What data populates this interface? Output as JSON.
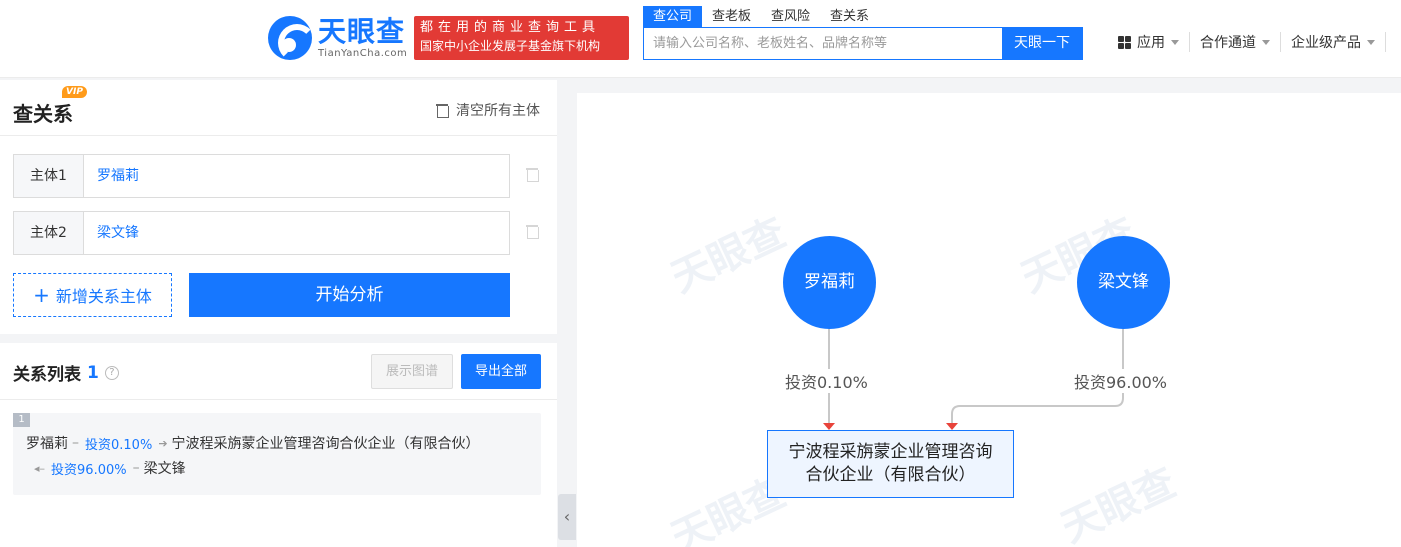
{
  "header": {
    "logo_cn": "天眼查",
    "logo_en": "TianYanCha.com",
    "slogan_line1": "都在用的商业查询工具",
    "slogan_line2": "国家中小企业发展子基金旗下机构",
    "search_tabs": [
      "查公司",
      "查老板",
      "查风险",
      "查关系"
    ],
    "search_placeholder": "请输入公司名称、老板姓名、品牌名称等",
    "search_button": "天眼一下",
    "nav": [
      "应用",
      "合作通道",
      "企业级产品"
    ]
  },
  "query": {
    "title": "查关系",
    "vip": "VIP",
    "clear_all": "清空所有主体",
    "entities": [
      {
        "label": "主体1",
        "value": "罗福莉"
      },
      {
        "label": "主体2",
        "value": "梁文锋"
      }
    ],
    "add_button": "新增关系主体",
    "start_button": "开始分析"
  },
  "relation_list": {
    "title": "关系列表",
    "count": "1",
    "show_map_button": "展示图谱",
    "export_button": "导出全部",
    "items": [
      {
        "index": "1",
        "from": "罗福莉",
        "invest1": "投资0.10%",
        "company": "宁波程采旃蒙企业管理咨询合伙企业（有限合伙）",
        "invest2": "投资96.00%",
        "to": "梁文锋"
      }
    ]
  },
  "graph": {
    "watermark": "天眼查",
    "node_a": "罗福莉",
    "node_b": "梁文锋",
    "edge_a": "投资0.10%",
    "edge_b": "投资96.00%",
    "company_line1": "宁波程采旃蒙企业管理咨询",
    "company_line2": "合伙企业（有限合伙）",
    "edge_color": "#c8c8c8",
    "arrow_color": "#e8433a"
  }
}
